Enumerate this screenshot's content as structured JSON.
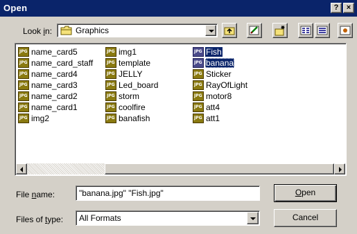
{
  "window": {
    "title": "Open",
    "help_glyph": "?",
    "close_glyph": "×"
  },
  "lookin": {
    "label_pre": "Look ",
    "label_u": "i",
    "label_post": "n:",
    "value": "Graphics",
    "icon": "folder-icon"
  },
  "toolbar": {
    "buttons": [
      {
        "name": "up-one-level-button",
        "icon": "folder-up-icon"
      },
      {
        "name": "desktop-button",
        "icon": "desktop-icon"
      },
      {
        "name": "new-folder-button",
        "icon": "new-folder-icon"
      },
      {
        "name": "list-view-button",
        "icon": "list-view-icon"
      },
      {
        "name": "details-view-button",
        "icon": "details-view-icon"
      },
      {
        "name": "preview-button",
        "icon": "preview-icon"
      }
    ]
  },
  "files": {
    "col1": [
      "name_card5",
      "name_card_staff",
      "name_card4",
      "name_card3",
      "name_card2",
      "name_card1",
      "img2"
    ],
    "col2": [
      "img1",
      "template",
      "JELLY",
      "Led_board",
      "storm",
      "coolfire",
      "banafish"
    ],
    "col3": [
      "Fish",
      "banana",
      "Sticker",
      "RayOfLight",
      "motor8",
      "att4",
      "att1"
    ],
    "selected": [
      "Fish",
      "banana"
    ]
  },
  "filename": {
    "label_pre": "File ",
    "label_u": "n",
    "label_post": "ame:",
    "value": "\"banana.jpg\" \"Fish.jpg\""
  },
  "filetype": {
    "label_pre": "Files of ",
    "label_u": "t",
    "label_post": "ype:",
    "value": "All Formats"
  },
  "buttons": {
    "open_u": "O",
    "open_rest": "pen",
    "cancel": "Cancel"
  },
  "colors": {
    "titlebar": "#0a246a",
    "face": "#d4d0c8",
    "selection": "#0a246a"
  }
}
